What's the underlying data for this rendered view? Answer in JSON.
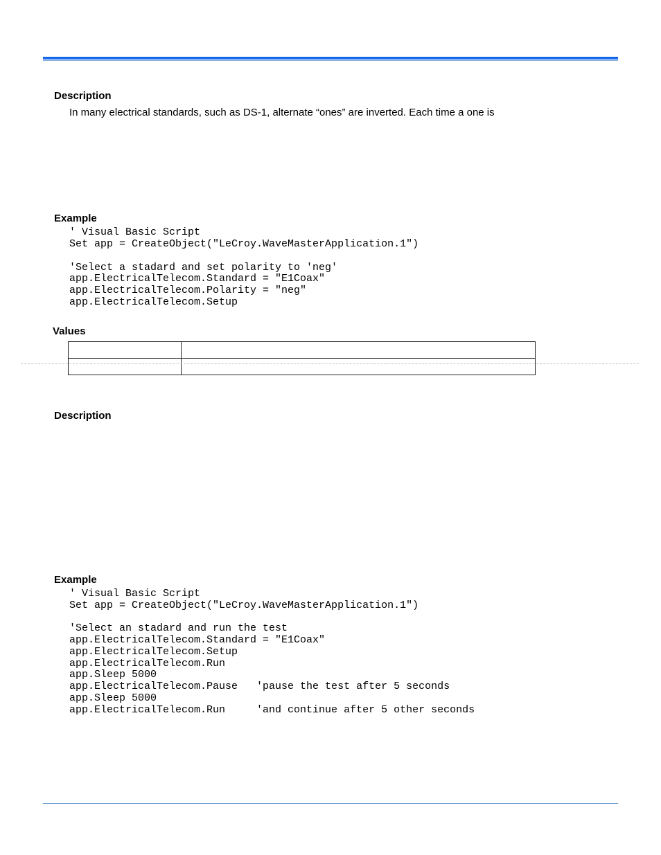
{
  "section1": {
    "heading": "Description",
    "text": "In many electrical standards, such as DS-1, alternate “ones” are inverted. Each time a one is"
  },
  "section2": {
    "heading": "Example",
    "code": "' Visual Basic Script\nSet app = CreateObject(\"LeCroy.WaveMasterApplication.1\")\n\n'Select a stadard and set polarity to 'neg'\napp.ElectricalTelecom.Standard = \"E1Coax\"\napp.ElectricalTelecom.Polarity = \"neg\"\napp.ElectricalTelecom.Setup"
  },
  "values": {
    "heading": "Values",
    "rows": [
      {
        "c1": "",
        "c2": ""
      },
      {
        "c1": "",
        "c2": ""
      }
    ]
  },
  "section3": {
    "heading": "Description",
    "text": ""
  },
  "section4": {
    "heading": "Example",
    "code": "' Visual Basic Script\nSet app = CreateObject(\"LeCroy.WaveMasterApplication.1\")\n\n'Select an stadard and run the test\napp.ElectricalTelecom.Standard = \"E1Coax\"\napp.ElectricalTelecom.Setup\napp.ElectricalTelecom.Run\napp.Sleep 5000\napp.ElectricalTelecom.Pause   'pause the test after 5 seconds\napp.Sleep 5000\napp.ElectricalTelecom.Run     'and continue after 5 other seconds"
  }
}
